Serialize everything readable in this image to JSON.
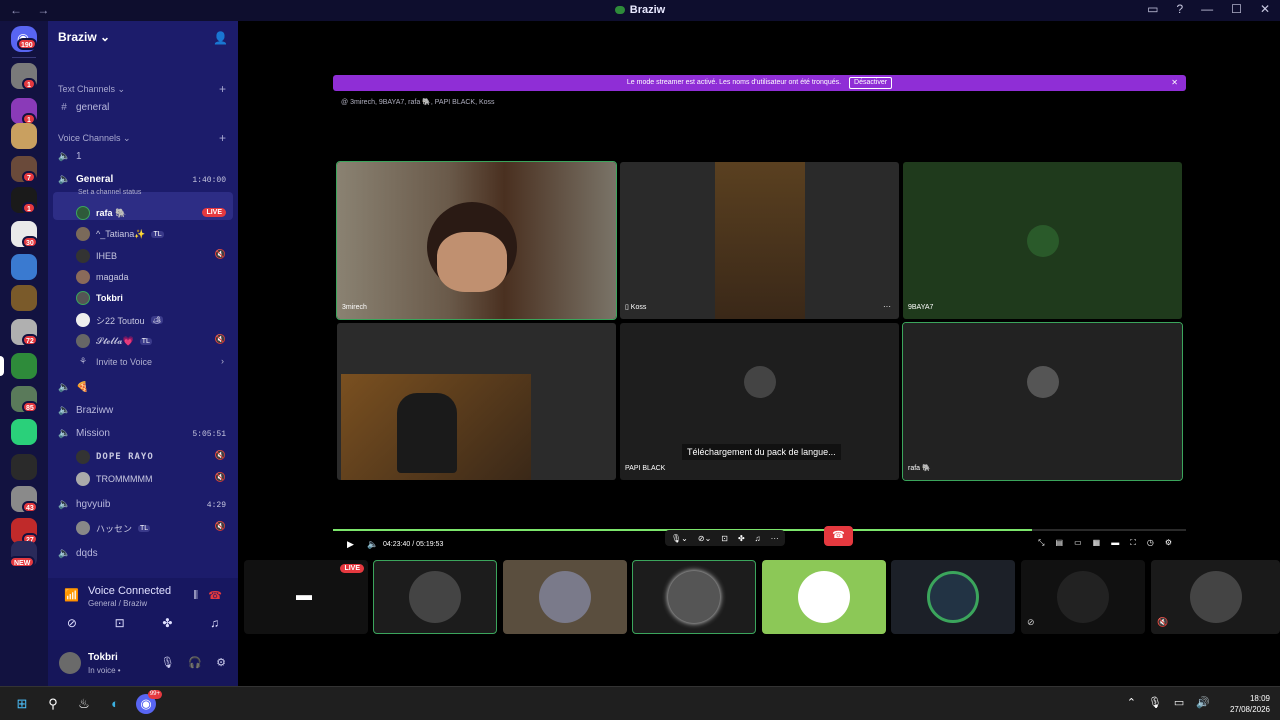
{
  "window": {
    "title": "Braziw",
    "nav_arrows": "← →",
    "controls": [
      "▭",
      "?",
      "—",
      "☐",
      "✕"
    ]
  },
  "servers": {
    "home_badge": "190",
    "items": [
      {
        "name": "server-1",
        "color": "#7a7a7a",
        "badge": "1"
      },
      {
        "name": "server-2",
        "color": "#8a3ab8",
        "badge": "1"
      },
      {
        "name": "server-3",
        "color": "#c9a060",
        "badge": ""
      },
      {
        "name": "server-4",
        "color": "#6a4a3a",
        "badge": "7"
      },
      {
        "name": "server-elite",
        "color": "#1a1a1a",
        "badge": "1"
      },
      {
        "name": "server-gg",
        "color": "#eaeaea",
        "badge": "30"
      },
      {
        "name": "server-5",
        "color": "#3a7ad0",
        "badge": ""
      },
      {
        "name": "server-6",
        "color": "#7a5a2a",
        "badge": ""
      },
      {
        "name": "server-7",
        "color": "#b0b0b0",
        "badge": "72"
      },
      {
        "name": "server-braziw",
        "color": "#2e8b3a",
        "badge": ""
      },
      {
        "name": "server-8",
        "color": "#5a7a5a",
        "badge": "85"
      },
      {
        "name": "server-k",
        "color": "#2ad07a",
        "badge": ""
      },
      {
        "name": "server-9",
        "color": "#2a2a2a",
        "badge": ""
      },
      {
        "name": "server-10",
        "color": "#8a8a8a",
        "badge": "43"
      },
      {
        "name": "server-11",
        "color": "#c02a2a",
        "badge": "27"
      },
      {
        "name": "server-12",
        "color": "#2a2a5a",
        "badge": ""
      }
    ],
    "new_label": "NEW"
  },
  "guild": {
    "name": "Braziw",
    "text_section": "Text Channels",
    "text_channels": [
      "general"
    ],
    "voice_section": "Voice Channels",
    "voice_1": "1",
    "general": {
      "name": "General",
      "status": "Set a channel status",
      "timer": "1:40:00"
    },
    "members": [
      {
        "name": "rafa 🐘",
        "live": "LIVE",
        "bold": true
      },
      {
        "name": "^_Tatiana✨",
        "tag": "TL"
      },
      {
        "name": "IHEB"
      },
      {
        "name": "magada"
      },
      {
        "name": "Tokbri",
        "bold": true
      },
      {
        "name": "シ22 Toutou",
        "tag": "🏕"
      },
      {
        "name": "𝓢𝓽𝓮𝓵𝓵𝓪💗",
        "tag": "TL"
      }
    ],
    "invite": "Invite to Voice",
    "pizza_channel": "🍕",
    "braziww": "Braziww",
    "mission": {
      "name": "Mission",
      "timer": "5:05:51",
      "members": [
        "DOPE RAYO",
        "TROMMMMM"
      ]
    },
    "hgvyuib": {
      "name": "hgvyuib",
      "timer": "4:29",
      "members": [
        "ハッセン"
      ]
    },
    "dqds": "dqds"
  },
  "voice_connected": {
    "title": "Voice Connected",
    "subtitle": "General / Braziw"
  },
  "user": {
    "name": "Tokbri",
    "status": "In voice •"
  },
  "stage": {
    "banner": "Le mode streamer est activé. Les noms d'utilisateur ont été tronqués.",
    "banner_button": "Désactiver",
    "participants": "3mirech, 9BAYA7, rafa 🐘, PAPI BLACK, Koss",
    "tiles": [
      {
        "label": "3mirech",
        "bg": "#6a5e52",
        "border": "#3ba55c"
      },
      {
        "label": "Koss",
        "bg": "#2a2a2a",
        "border": ""
      },
      {
        "label": "9BAYA7",
        "bg": "#1f3a1c",
        "border": ""
      },
      {
        "label": "",
        "bg": "#2b2b2b",
        "border": ""
      },
      {
        "label": "PAPI BLACK",
        "bg": "#1e1e1e",
        "border": ""
      },
      {
        "label": "rafa 🐘",
        "bg": "#222",
        "border": "#3ba55c"
      }
    ],
    "caption": "Téléchargement du pack de langue...",
    "time": "04:23:40 / 05:19:53",
    "strip_live": "LIVE"
  },
  "taskbar": {
    "time": "18:09",
    "date": "27/08/2026",
    "discord_badge": "99+"
  }
}
